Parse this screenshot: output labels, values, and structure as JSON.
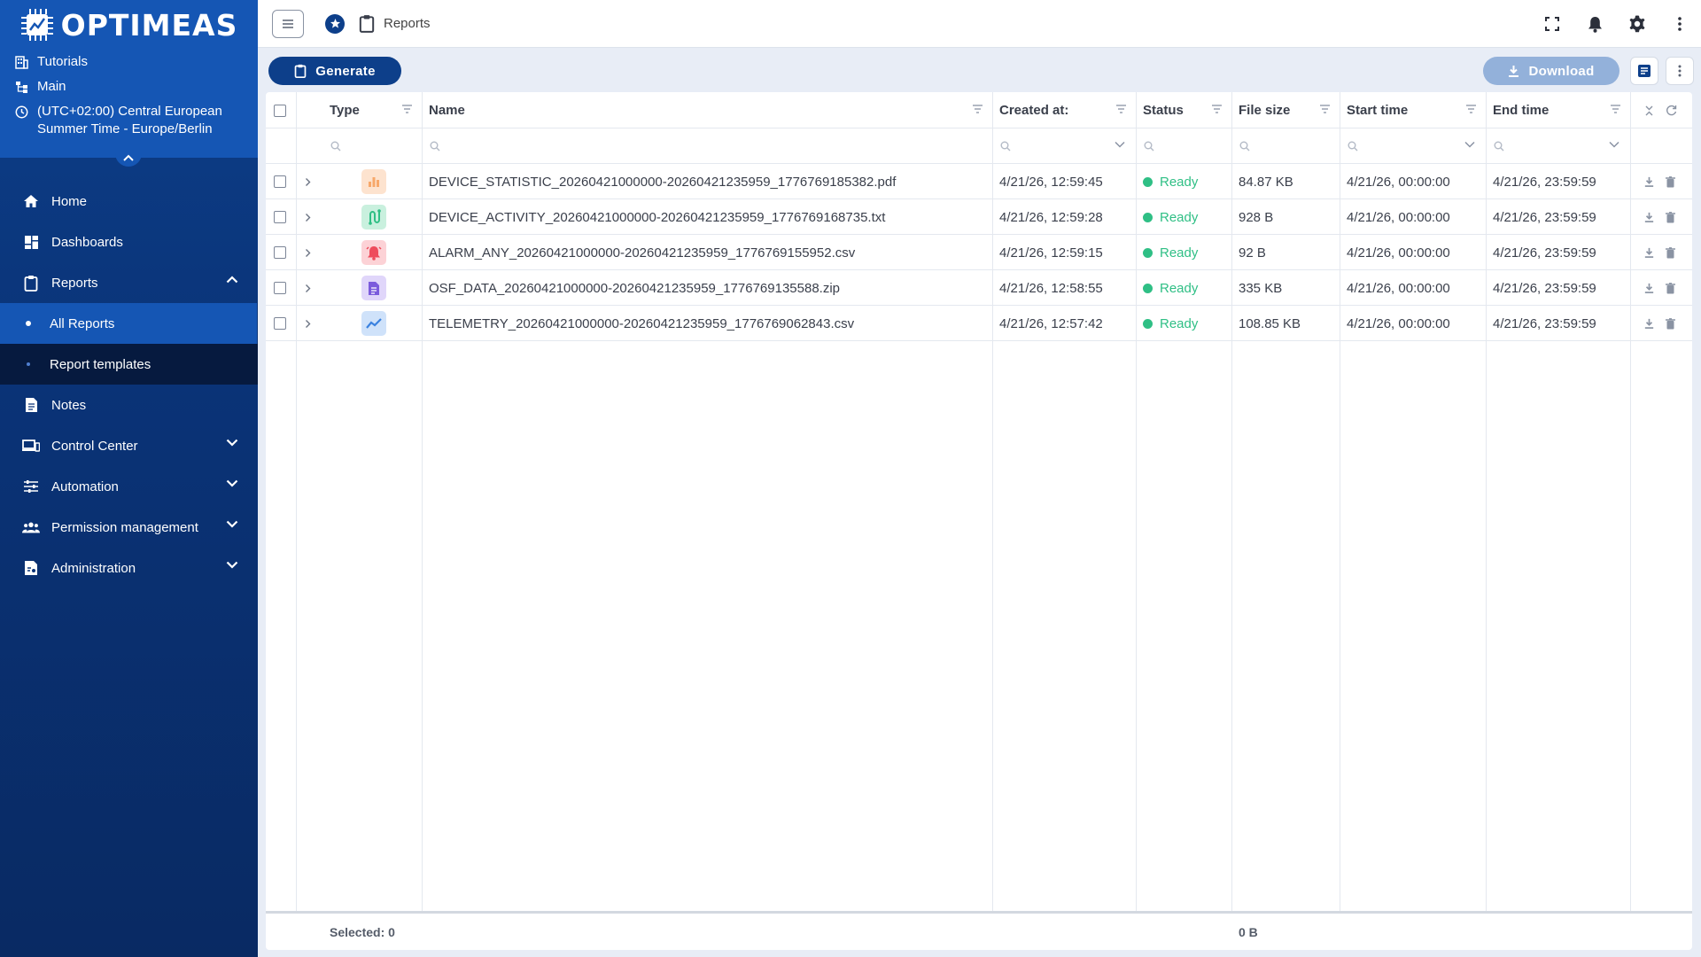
{
  "brand": {
    "name": "OPTIMEAS"
  },
  "context": [
    {
      "icon": "building-icon",
      "label": "Tutorials"
    },
    {
      "icon": "hierarchy-icon",
      "label": "Main"
    },
    {
      "icon": "clock-icon",
      "label": "(UTC+02:00) Central European Summer Time - Europe/Berlin"
    }
  ],
  "nav": {
    "home": "Home",
    "dashboards": "Dashboards",
    "reports": "Reports",
    "all_reports": "All Reports",
    "report_templates": "Report templates",
    "notes": "Notes",
    "control_center": "Control Center",
    "automation": "Automation",
    "permission_management": "Permission management",
    "administration": "Administration"
  },
  "topbar": {
    "breadcrumb": "Reports"
  },
  "toolbar": {
    "generate_label": "Generate",
    "download_label": "Download"
  },
  "table": {
    "headers": {
      "type": "Type",
      "name": "Name",
      "created": "Created at:",
      "status": "Status",
      "size": "File size",
      "start": "Start time",
      "end": "End time"
    },
    "rows": [
      {
        "type_icon": "bar-chart-icon",
        "type_color": "#f7a86a",
        "type_bg": "#fde3cf",
        "name": "DEVICE_STATISTIC_20260421000000-20260421235959_1776769185382.pdf",
        "created": "4/21/26, 12:59:45",
        "status": "Ready",
        "size": "84.87 KB",
        "start": "4/21/26, 00:00:00",
        "end": "4/21/26, 23:59:59"
      },
      {
        "type_icon": "activity-icon",
        "type_color": "#2fbf85",
        "type_bg": "#c9f0de",
        "name": "DEVICE_ACTIVITY_20260421000000-20260421235959_1776769168735.txt",
        "created": "4/21/26, 12:59:28",
        "status": "Ready",
        "size": "928 B",
        "start": "4/21/26, 00:00:00",
        "end": "4/21/26, 23:59:59"
      },
      {
        "type_icon": "alarm-bell-icon",
        "type_color": "#ee4c5c",
        "type_bg": "#fcd2d6",
        "name": "ALARM_ANY_20260421000000-20260421235959_1776769155952.csv",
        "created": "4/21/26, 12:59:15",
        "status": "Ready",
        "size": "92 B",
        "start": "4/21/26, 00:00:00",
        "end": "4/21/26, 23:59:59"
      },
      {
        "type_icon": "document-icon",
        "type_color": "#7b5bdc",
        "type_bg": "#e0d6fa",
        "name": "OSF_DATA_20260421000000-20260421235959_1776769135588.zip",
        "created": "4/21/26, 12:58:55",
        "status": "Ready",
        "size": "335 KB",
        "start": "4/21/26, 00:00:00",
        "end": "4/21/26, 23:59:59"
      },
      {
        "type_icon": "trend-line-icon",
        "type_color": "#3b82e0",
        "type_bg": "#cfe2fa",
        "name": "TELEMETRY_20260421000000-20260421235959_1776769062843.csv",
        "created": "4/21/26, 12:57:42",
        "status": "Ready",
        "size": "108.85 KB",
        "start": "4/21/26, 00:00:00",
        "end": "4/21/26, 23:59:59"
      }
    ],
    "footer": {
      "selected": "Selected: 0",
      "total_size": "0 B"
    }
  }
}
